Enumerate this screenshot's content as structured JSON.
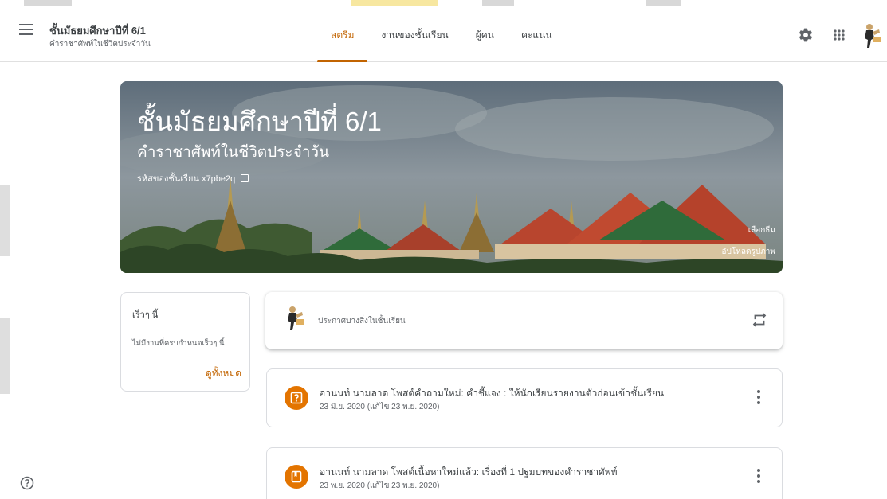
{
  "header": {
    "class_title": "ชั้นมัธยมศึกษาปีที่ 6/1",
    "class_subtitle": "คำราชาศัพท์ในชีวิตประจำวัน",
    "tabs": [
      {
        "label": "สตรีม",
        "active": true
      },
      {
        "label": "งานของชั้นเรียน",
        "active": false
      },
      {
        "label": "ผู้คน",
        "active": false
      },
      {
        "label": "คะแนน",
        "active": false
      }
    ],
    "icons": [
      "gear-icon",
      "apps-grid-icon",
      "avatar"
    ]
  },
  "banner": {
    "title": "ชั้นมัธยมศึกษาปีที่ 6/1",
    "subtitle": "คำราชาศัพท์ในชีวิตประจำวัน",
    "class_code_label": "รหัสของชั้นเรียน",
    "class_code": "x7pbe2q",
    "select_theme": "เลือกธีม",
    "upload_photo": "อัปโหลดรูปภาพ"
  },
  "upcoming": {
    "title": "เร็วๆ นี้",
    "empty_text": "ไม่มีงานที่ครบกำหนดเร็วๆ นี้",
    "view_all": "ดูทั้งหมด"
  },
  "announce": {
    "placeholder": "ประกาศบางสิ่งในชั้นเรียน"
  },
  "posts": [
    {
      "title": "อานนท์ นามลาด โพสต์คำถามใหม่: คำชี้แจง : ให้นักเรียนรายงานตัวก่อนเข้าชั้นเรียน",
      "date": "23 มิ.ย. 2020 (แก้ไข 23 พ.ย. 2020)",
      "icon": "question-icon"
    },
    {
      "title": "อานนท์ นามลาด โพสต์เนื้อหาใหม่แล้ว: เรื่องที่ 1 ปฐมบทของคำราชาศัพท์",
      "date": "23 พ.ย. 2020 (แก้ไข 23 พ.ย. 2020)",
      "icon": "material-icon"
    }
  ],
  "colors": {
    "accent": "#c26401",
    "post_icon_bg": "#e37400"
  }
}
